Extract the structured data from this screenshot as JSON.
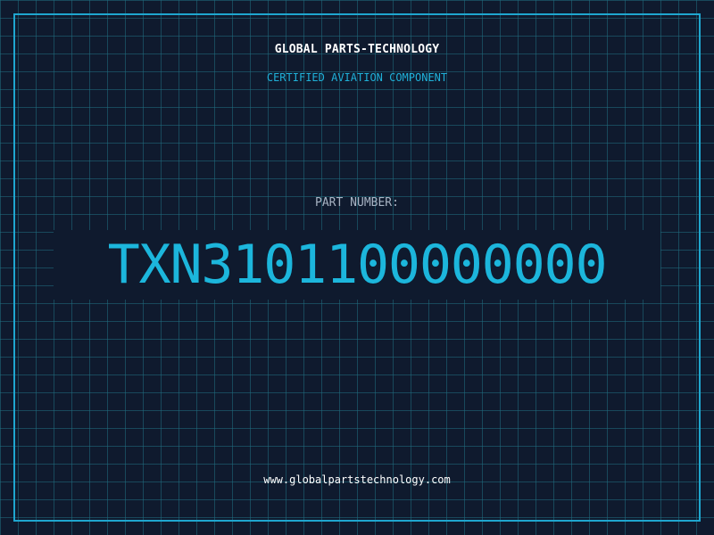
{
  "header": {
    "company": "GLOBAL PARTS-TECHNOLOGY",
    "tagline": "CERTIFIED AVIATION COMPONENT"
  },
  "part": {
    "label": "PART NUMBER:",
    "number": "TXN3101100000000"
  },
  "footer": {
    "website": "www.globalpartstechnology.com"
  },
  "colors": {
    "background": "#0f1a2e",
    "grid": "#206e80",
    "border": "#1fa6cf",
    "accent": "#1cb6dc",
    "company_text": "#ffffff",
    "label_text": "#a8b4c4"
  }
}
